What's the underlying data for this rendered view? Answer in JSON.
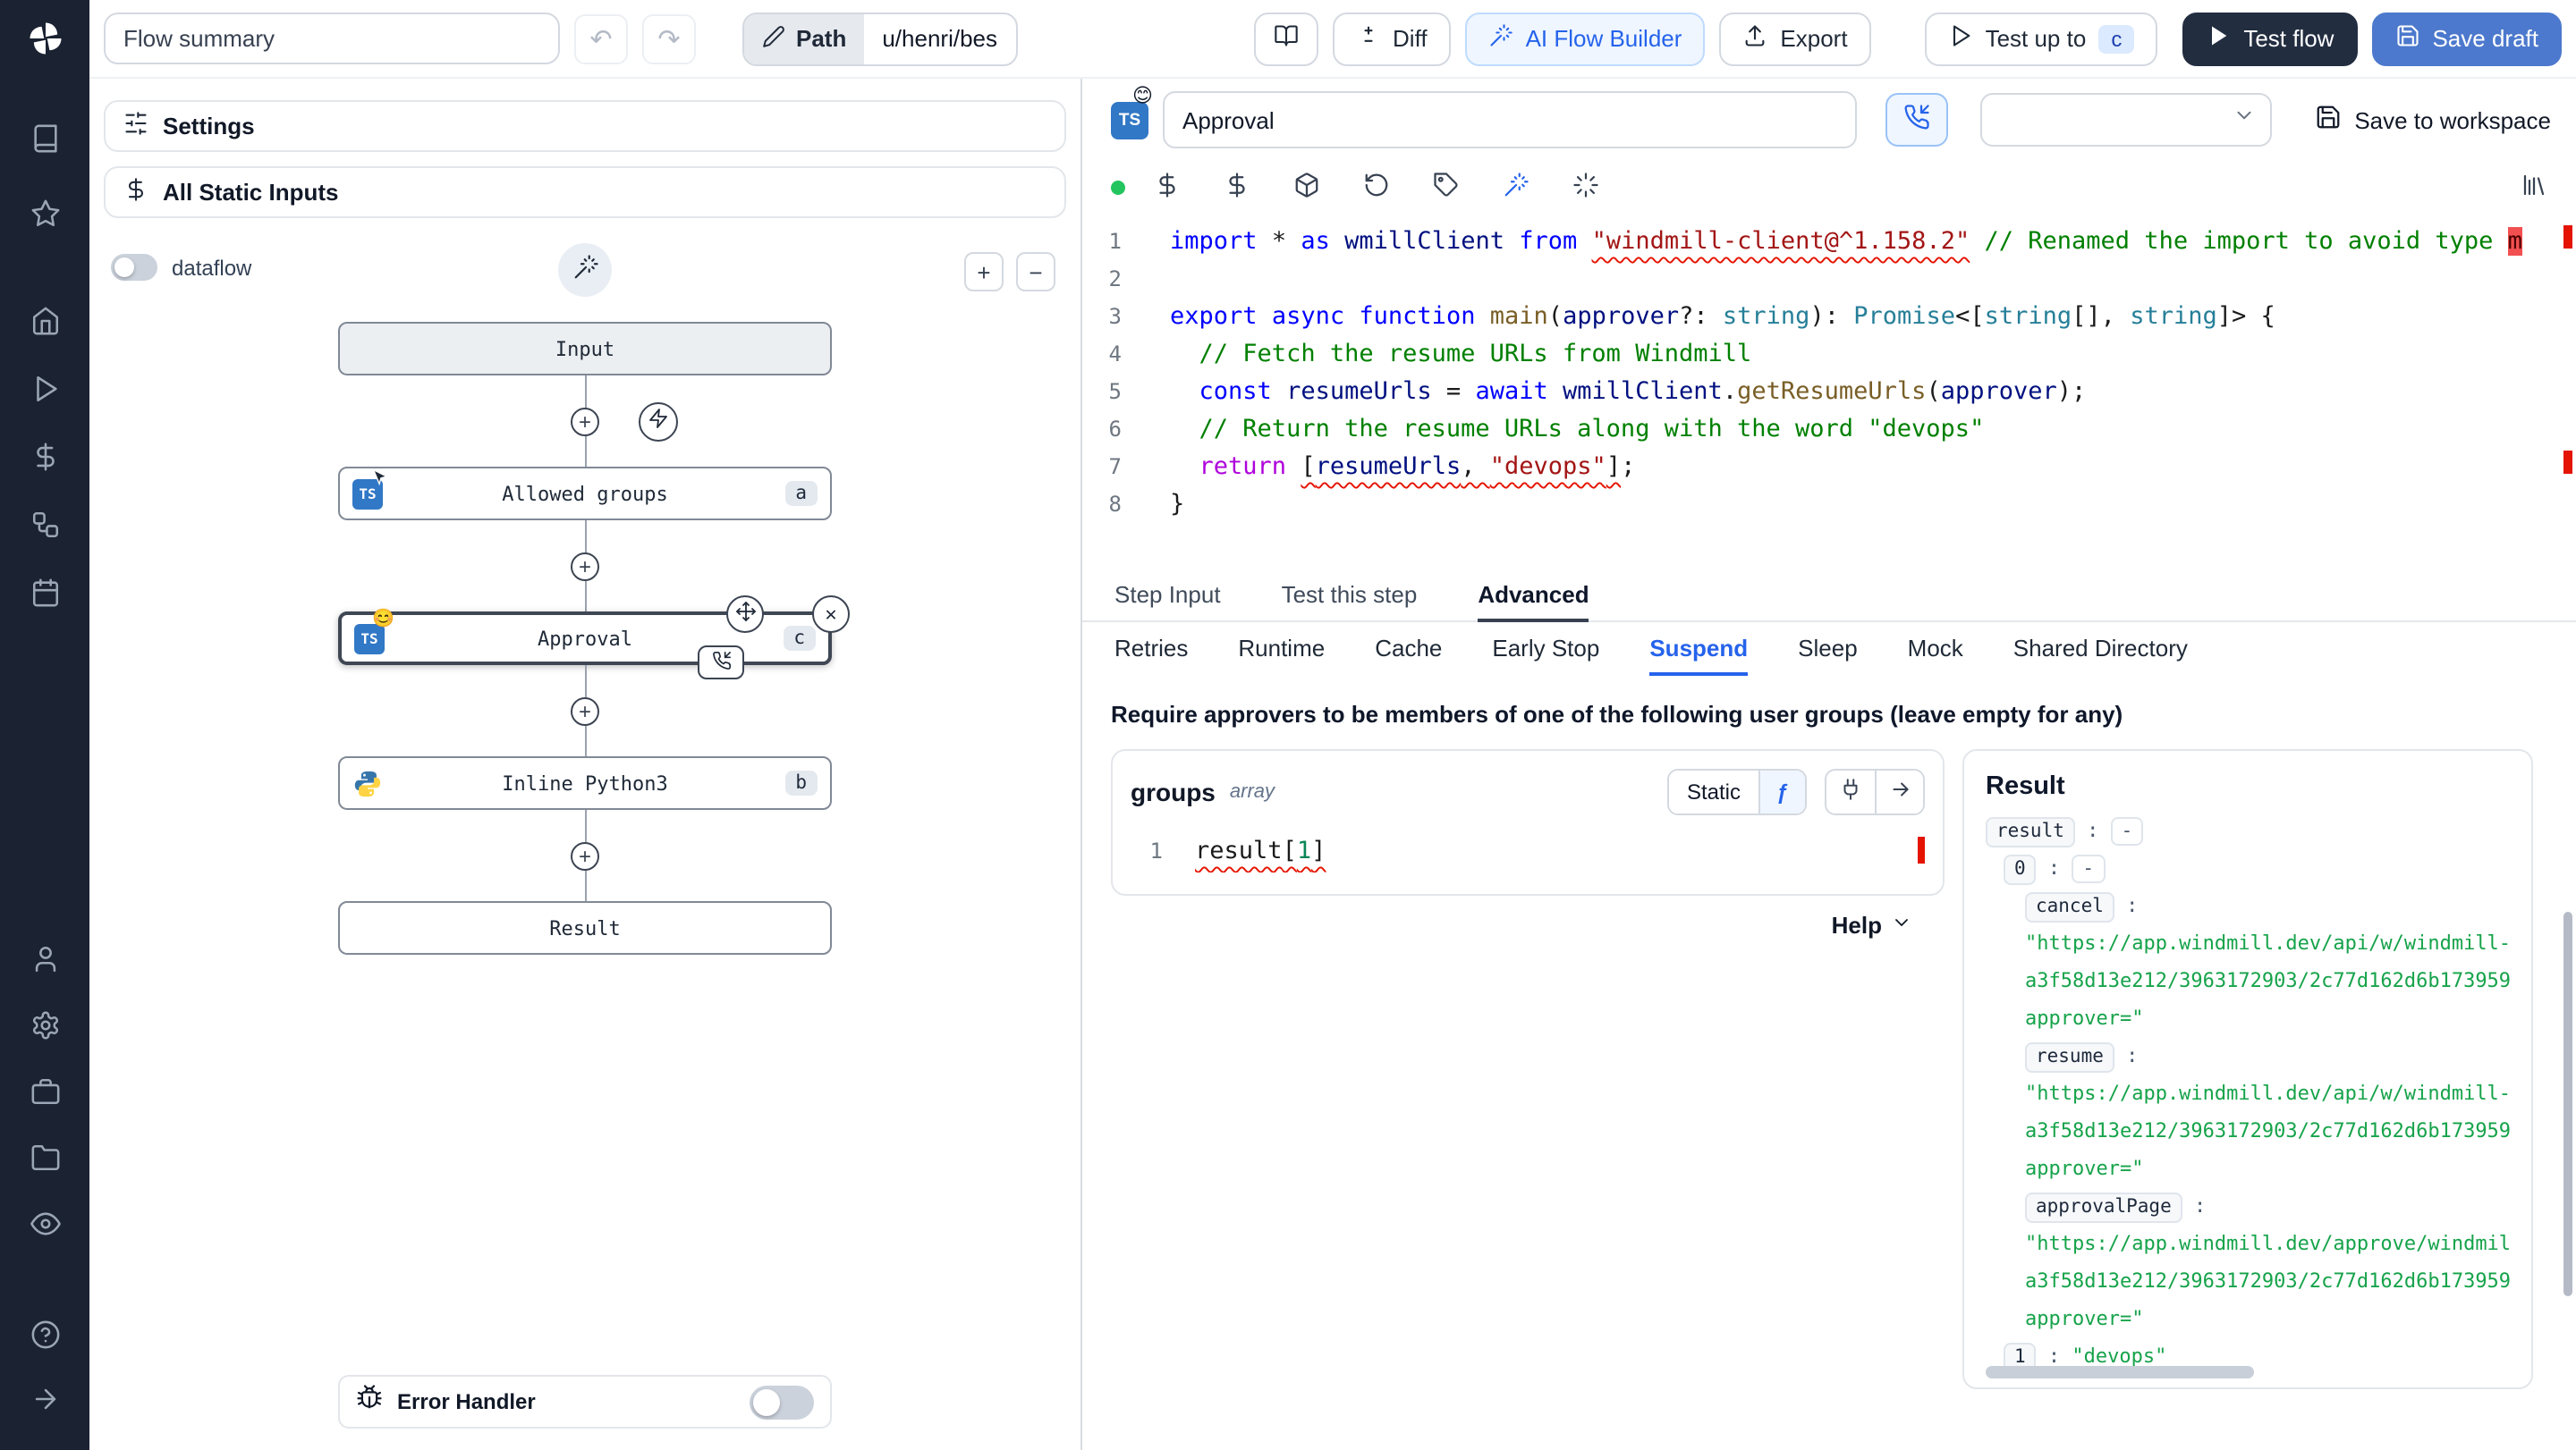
{
  "colors": {
    "accent_blue": "#2563eb",
    "save_draft_bg": "#4c79cd",
    "test_flow_bg": "#222d40",
    "sidebar_bg": "#1b2232",
    "ts_badge_bg": "#3178c6",
    "string_green": "#16a34a",
    "error_red": "#e51400",
    "assistant_ready_green": "#22c55e"
  },
  "icons": {
    "undo": "↶",
    "redo": "↷",
    "plus": "+",
    "zoom_in": "+",
    "zoom_out": "−",
    "close": "✕",
    "fx": "ƒ"
  },
  "sidebar": {
    "icon_names": [
      "windmill-logo",
      "docs",
      "favorites",
      "home",
      "runs",
      "variables",
      "flows",
      "schedules",
      "user",
      "settings",
      "workers",
      "folders",
      "audit-logs",
      "help",
      "collapse-sidebar"
    ]
  },
  "topbar": {
    "flow_summary": {
      "value": "Flow summary",
      "placeholder": "Flow summary"
    },
    "path_label": "Path",
    "path_value": "u/henri/bes",
    "diff_label": "Diff",
    "ai_flow_builder_label": "AI Flow Builder",
    "export_label": "Export",
    "test_up_to_label": "Test up to",
    "test_up_to_badge": "c",
    "test_flow_label": "Test flow",
    "save_draft_label": "Save draft"
  },
  "flow_panel": {
    "settings_label": "Settings",
    "static_inputs_label": "All Static Inputs",
    "dataflow_label": "dataflow",
    "ts_label": "TS",
    "nodes": {
      "input": {
        "label": "Input"
      },
      "allowed_groups": {
        "label": "Allowed groups",
        "badge": "a"
      },
      "approval": {
        "label": "Approval",
        "badge": "c",
        "emoji": "😊",
        "selected": true
      },
      "inline_python": {
        "label": "Inline Python3",
        "badge": "b"
      },
      "result": {
        "label": "Result"
      }
    },
    "error_handler_label": "Error Handler"
  },
  "step_panel": {
    "lang_badge": "TS",
    "emoji_badge": "😊",
    "name_input": {
      "value": "Approval"
    },
    "select_value": "",
    "save_to_workspace_label": "Save to workspace",
    "tabs": [
      {
        "label": "Step Input"
      },
      {
        "label": "Test this step"
      },
      {
        "label": "Advanced",
        "active": true
      }
    ],
    "subtabs": [
      {
        "label": "Retries"
      },
      {
        "label": "Runtime"
      },
      {
        "label": "Cache"
      },
      {
        "label": "Early Stop"
      },
      {
        "label": "Suspend",
        "active": true
      },
      {
        "label": "Sleep"
      },
      {
        "label": "Mock"
      },
      {
        "label": "Shared Directory"
      }
    ]
  },
  "editor": {
    "lines": [
      {
        "n": 1,
        "tokens": [
          {
            "t": "import",
            "c": "kw"
          },
          {
            "t": " * ",
            "c": "pl"
          },
          {
            "t": "as",
            "c": "kw"
          },
          {
            "t": " ",
            "c": "pl"
          },
          {
            "t": "wmillClient",
            "c": "vr"
          },
          {
            "t": " ",
            "c": "pl"
          },
          {
            "t": "from",
            "c": "kw"
          },
          {
            "t": " ",
            "c": "pl"
          },
          {
            "t": "\"windmill-client@^1.158.2\"",
            "c": "str sq"
          },
          {
            "t": " ",
            "c": "pl"
          },
          {
            "t": "// Renamed the import to avoid type ",
            "c": "cm"
          },
          {
            "t": "m",
            "c": "cm hlred"
          }
        ]
      },
      {
        "n": 2,
        "tokens": []
      },
      {
        "n": 3,
        "tokens": [
          {
            "t": "export",
            "c": "kw"
          },
          {
            "t": " ",
            "c": "pl"
          },
          {
            "t": "async",
            "c": "kw"
          },
          {
            "t": " ",
            "c": "pl"
          },
          {
            "t": "function",
            "c": "kw"
          },
          {
            "t": " ",
            "c": "pl"
          },
          {
            "t": "main",
            "c": "fn"
          },
          {
            "t": "(",
            "c": "pl"
          },
          {
            "t": "approver",
            "c": "vr"
          },
          {
            "t": "?: ",
            "c": "pl"
          },
          {
            "t": "string",
            "c": "ty"
          },
          {
            "t": "): ",
            "c": "pl"
          },
          {
            "t": "Promise",
            "c": "ty"
          },
          {
            "t": "<[",
            "c": "pl"
          },
          {
            "t": "string",
            "c": "ty"
          },
          {
            "t": "[], ",
            "c": "pl"
          },
          {
            "t": "string",
            "c": "ty"
          },
          {
            "t": "]> {",
            "c": "pl"
          }
        ]
      },
      {
        "n": 4,
        "tokens": [
          {
            "t": "  ",
            "c": "pl"
          },
          {
            "t": "// Fetch the resume URLs from Windmill",
            "c": "cm"
          }
        ]
      },
      {
        "n": 5,
        "tokens": [
          {
            "t": "  ",
            "c": "pl"
          },
          {
            "t": "const",
            "c": "kw"
          },
          {
            "t": " ",
            "c": "pl"
          },
          {
            "t": "resumeUrls",
            "c": "vr"
          },
          {
            "t": " = ",
            "c": "pl"
          },
          {
            "t": "await",
            "c": "kw"
          },
          {
            "t": " ",
            "c": "pl"
          },
          {
            "t": "wmillClient",
            "c": "vr"
          },
          {
            "t": ".",
            "c": "pl"
          },
          {
            "t": "getResumeUrls",
            "c": "fn"
          },
          {
            "t": "(",
            "c": "pl"
          },
          {
            "t": "approver",
            "c": "vr"
          },
          {
            "t": ");",
            "c": "pl"
          }
        ]
      },
      {
        "n": 6,
        "tokens": [
          {
            "t": "  ",
            "c": "pl"
          },
          {
            "t": "// Return the resume URLs along with the word \"devops\"",
            "c": "cm"
          }
        ]
      },
      {
        "n": 7,
        "tokens": [
          {
            "t": "  ",
            "c": "pl"
          },
          {
            "t": "return",
            "c": "kwf"
          },
          {
            "t": " ",
            "c": "pl"
          },
          {
            "t": "[",
            "c": "pl sq"
          },
          {
            "t": "resumeUrls",
            "c": "vr sq"
          },
          {
            "t": ", ",
            "c": "pl sq"
          },
          {
            "t": "\"devops\"",
            "c": "str sq"
          },
          {
            "t": "]",
            "c": "pl sq"
          },
          {
            "t": ";",
            "c": "pl"
          }
        ]
      },
      {
        "n": 8,
        "tokens": [
          {
            "t": "}",
            "c": "pl"
          }
        ]
      }
    ]
  },
  "suspend": {
    "prompt": "Require approvers to be members of one of the following user groups (leave empty for any)",
    "groups": {
      "title": "groups",
      "type_label": "array",
      "static_label": "Static",
      "help_label": "Help",
      "editor_lines": [
        {
          "n": 1,
          "tokens": [
            {
              "t": "result",
              "c": "pl sq"
            },
            {
              "t": "[",
              "c": "pl sq"
            },
            {
              "t": "1",
              "c": "num sq"
            },
            {
              "t": "]",
              "c": "pl sq"
            }
          ]
        }
      ]
    },
    "result_panel": {
      "title": "Result",
      "rows": [
        {
          "indent": 0,
          "key": "result",
          "value": "-",
          "collapse": true
        },
        {
          "indent": 1,
          "key": "0",
          "value": "-",
          "collapse": true
        },
        {
          "indent": 2,
          "key": "cancel",
          "lines": [
            "\"https://app.windmill.dev/api/w/windmill-labs/jobs",
            "a3f58d13e212/3963172903/2c77d162d6b173959",
            "approver=\""
          ]
        },
        {
          "indent": 2,
          "key": "resume",
          "lines": [
            "\"https://app.windmill.dev/api/w/windmill-labs/jobs",
            "a3f58d13e212/3963172903/2c77d162d6b173959",
            "approver=\""
          ]
        },
        {
          "indent": 2,
          "key": "approvalPage",
          "lines": [
            "\"https://app.windmill.dev/approve/windmill-labs/C",
            "a3f58d13e212/3963172903/2c77d162d6b173959",
            "approver=\""
          ]
        },
        {
          "indent": 1,
          "key": "1",
          "value": "\"devops\"",
          "string": true
        }
      ]
    }
  }
}
